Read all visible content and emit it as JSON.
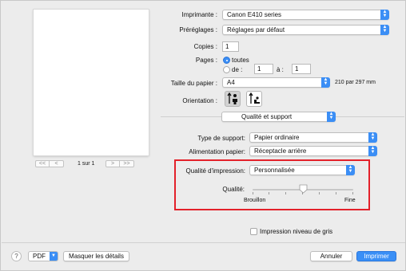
{
  "preview": {
    "prev_first": "<<",
    "prev": "<",
    "page_counter": "1 sur 1",
    "next": ">",
    "next_last": ">>"
  },
  "form": {
    "printer_label": "Imprimante :",
    "printer_value": "Canon E410 series",
    "presets_label": "Préréglages :",
    "presets_value": "Réglages par défaut",
    "copies_label": "Copies :",
    "copies_value": "1",
    "pages_label": "Pages :",
    "pages_all": "toutes",
    "pages_from": "de :",
    "pages_from_value": "1",
    "pages_to": "à :",
    "pages_to_value": "1",
    "paper_size_label": "Taille du papier :",
    "paper_size_value": "A4",
    "paper_size_dims": "210 par 297 mm",
    "orientation_label": "Orientation :",
    "section_value": "Qualité et support",
    "media_type_label": "Type de support:",
    "media_type_value": "Papier ordinaire",
    "paper_source_label": "Alimentation papier:",
    "paper_source_value": "Réceptacle arrière",
    "print_quality_label": "Qualité d'impression:",
    "print_quality_value": "Personnalisée",
    "quality_label": "Qualité:",
    "quality_low": "Brouillon",
    "quality_high": "Fine",
    "quality_level": 0.5,
    "grayscale_label": "Impression niveau de gris"
  },
  "footer": {
    "help": "?",
    "pdf": "PDF",
    "hide_details": "Masquer les détails",
    "cancel": "Annuler",
    "print": "Imprimer"
  },
  "colors": {
    "accent": "#3b8ef5",
    "highlight_box": "#e3212a"
  }
}
